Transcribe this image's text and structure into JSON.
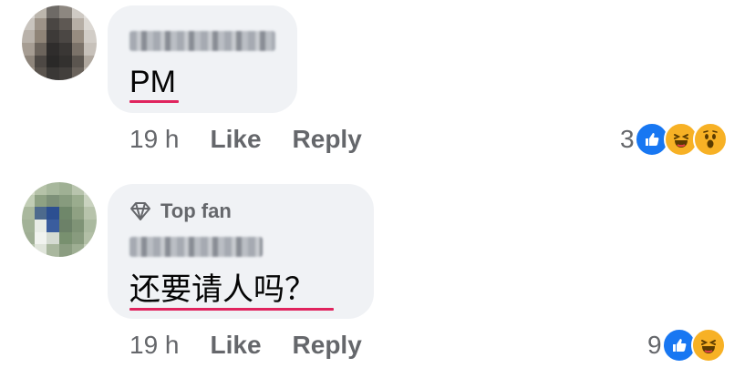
{
  "comments": [
    {
      "text": "PM",
      "time": "19 h",
      "like_label": "Like",
      "reply_label": "Reply",
      "reaction_count": "3",
      "reactions": [
        "like",
        "haha",
        "wow"
      ]
    },
    {
      "badge": "Top fan",
      "text": "还要请人吗？",
      "time": "19 h",
      "like_label": "Like",
      "reply_label": "Reply",
      "reaction_count": "9",
      "reactions": [
        "like",
        "haha"
      ]
    }
  ],
  "colors": {
    "bubble": "#f0f2f5",
    "secondary_text": "#65676b",
    "like_blue": "#1877f2",
    "reaction_yellow": "#f7b125",
    "spellcheck_underline": "#e0245e"
  },
  "icons": [
    "diamond-icon",
    "like-reaction-icon",
    "haha-reaction-icon",
    "wow-reaction-icon"
  ]
}
